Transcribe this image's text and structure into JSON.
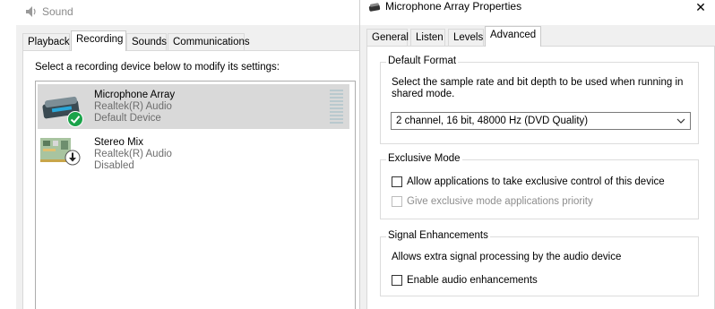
{
  "sound_window": {
    "title": "Sound",
    "tabs": [
      {
        "label": "Playback",
        "active": false
      },
      {
        "label": "Recording",
        "active": true
      },
      {
        "label": "Sounds",
        "active": false
      },
      {
        "label": "Communications",
        "active": false
      }
    ],
    "instruction": "Select a recording device below to modify its settings:",
    "devices": [
      {
        "name": "Microphone Array",
        "driver": "Realtek(R) Audio",
        "status": "Default Device",
        "icon": "microphone-array-icon",
        "badge": "default-check-icon",
        "selected": true
      },
      {
        "name": "Stereo Mix",
        "driver": "Realtek(R) Audio",
        "status": "Disabled",
        "icon": "stereo-mix-board-icon",
        "badge": "disabled-down-arrow-icon",
        "selected": false
      }
    ]
  },
  "properties_window": {
    "title": "Microphone Array Properties",
    "close_glyph": "✕",
    "tabs": [
      {
        "label": "General",
        "active": false
      },
      {
        "label": "Listen",
        "active": false
      },
      {
        "label": "Levels",
        "active": false
      },
      {
        "label": "Advanced",
        "active": true
      }
    ],
    "default_format": {
      "title": "Default Format",
      "description": "Select the sample rate and bit depth to be used when running in shared mode.",
      "selected_value": "2 channel, 16 bit, 48000 Hz (DVD Quality)"
    },
    "exclusive_mode": {
      "title": "Exclusive Mode",
      "options": [
        {
          "label": "Allow applications to take exclusive control of this device",
          "checked": false,
          "enabled": true
        },
        {
          "label": "Give exclusive mode applications priority",
          "checked": false,
          "enabled": false
        }
      ]
    },
    "signal_enhancements": {
      "title": "Signal Enhancements",
      "description": "Allows extra signal processing by the audio device",
      "option": {
        "label": "Enable audio enhancements",
        "checked": false,
        "enabled": true
      }
    }
  },
  "colors": {
    "selection": "#d9d9d9",
    "check_badge": "#1aa34a",
    "dialog_bg": "#f0f0f0",
    "disabled_text": "#8e8e8e"
  }
}
